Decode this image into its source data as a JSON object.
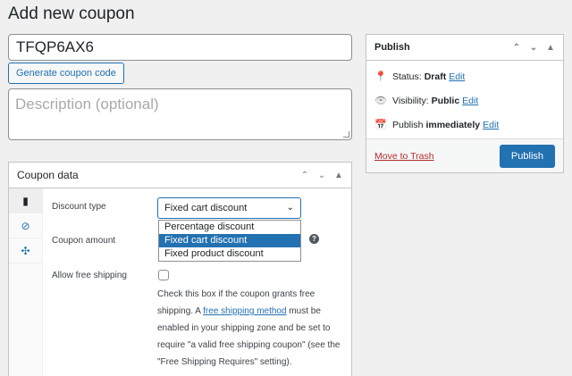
{
  "page": {
    "title": "Add new coupon"
  },
  "coupon": {
    "code": "TFQP6AX6",
    "generate_label": "Generate coupon code",
    "description_placeholder": "Description (optional)"
  },
  "publish": {
    "title": "Publish",
    "status_label": "Status:",
    "status_value": "Draft",
    "visibility_label": "Visibility:",
    "visibility_value": "Public",
    "publish_label": "Publish",
    "publish_value": "immediately",
    "edit_label": "Edit",
    "trash_label": "Move to Trash",
    "publish_button": "Publish"
  },
  "coupon_data": {
    "title": "Coupon data",
    "discount_type_label": "Discount type",
    "discount_type_selected": "Fixed cart discount",
    "discount_options": [
      "Percentage discount",
      "Fixed cart discount",
      "Fixed product discount"
    ],
    "coupon_amount_label": "Coupon amount",
    "free_shipping_label": "Allow free shipping",
    "free_shipping_desc_1": "Check this box if the coupon grants free shipping. A ",
    "free_shipping_link": "free shipping method",
    "free_shipping_desc_2": " must be enabled in your shipping zone and be set to require \"a valid free shipping coupon\" (see the \"Free Shipping Requires\" setting).",
    "help_icon_glyph": "?"
  },
  "icons": [
    "pin-icon",
    "eye-icon",
    "calendar-icon",
    "ticket-icon",
    "restriction-icon",
    "limits-icon",
    "chevron-up-icon",
    "chevron-down-icon",
    "toggle-arrow-icon"
  ],
  "colors": {
    "accent": "#2271b1",
    "trash": "#b32d2e",
    "background": "#f0f0f1"
  }
}
